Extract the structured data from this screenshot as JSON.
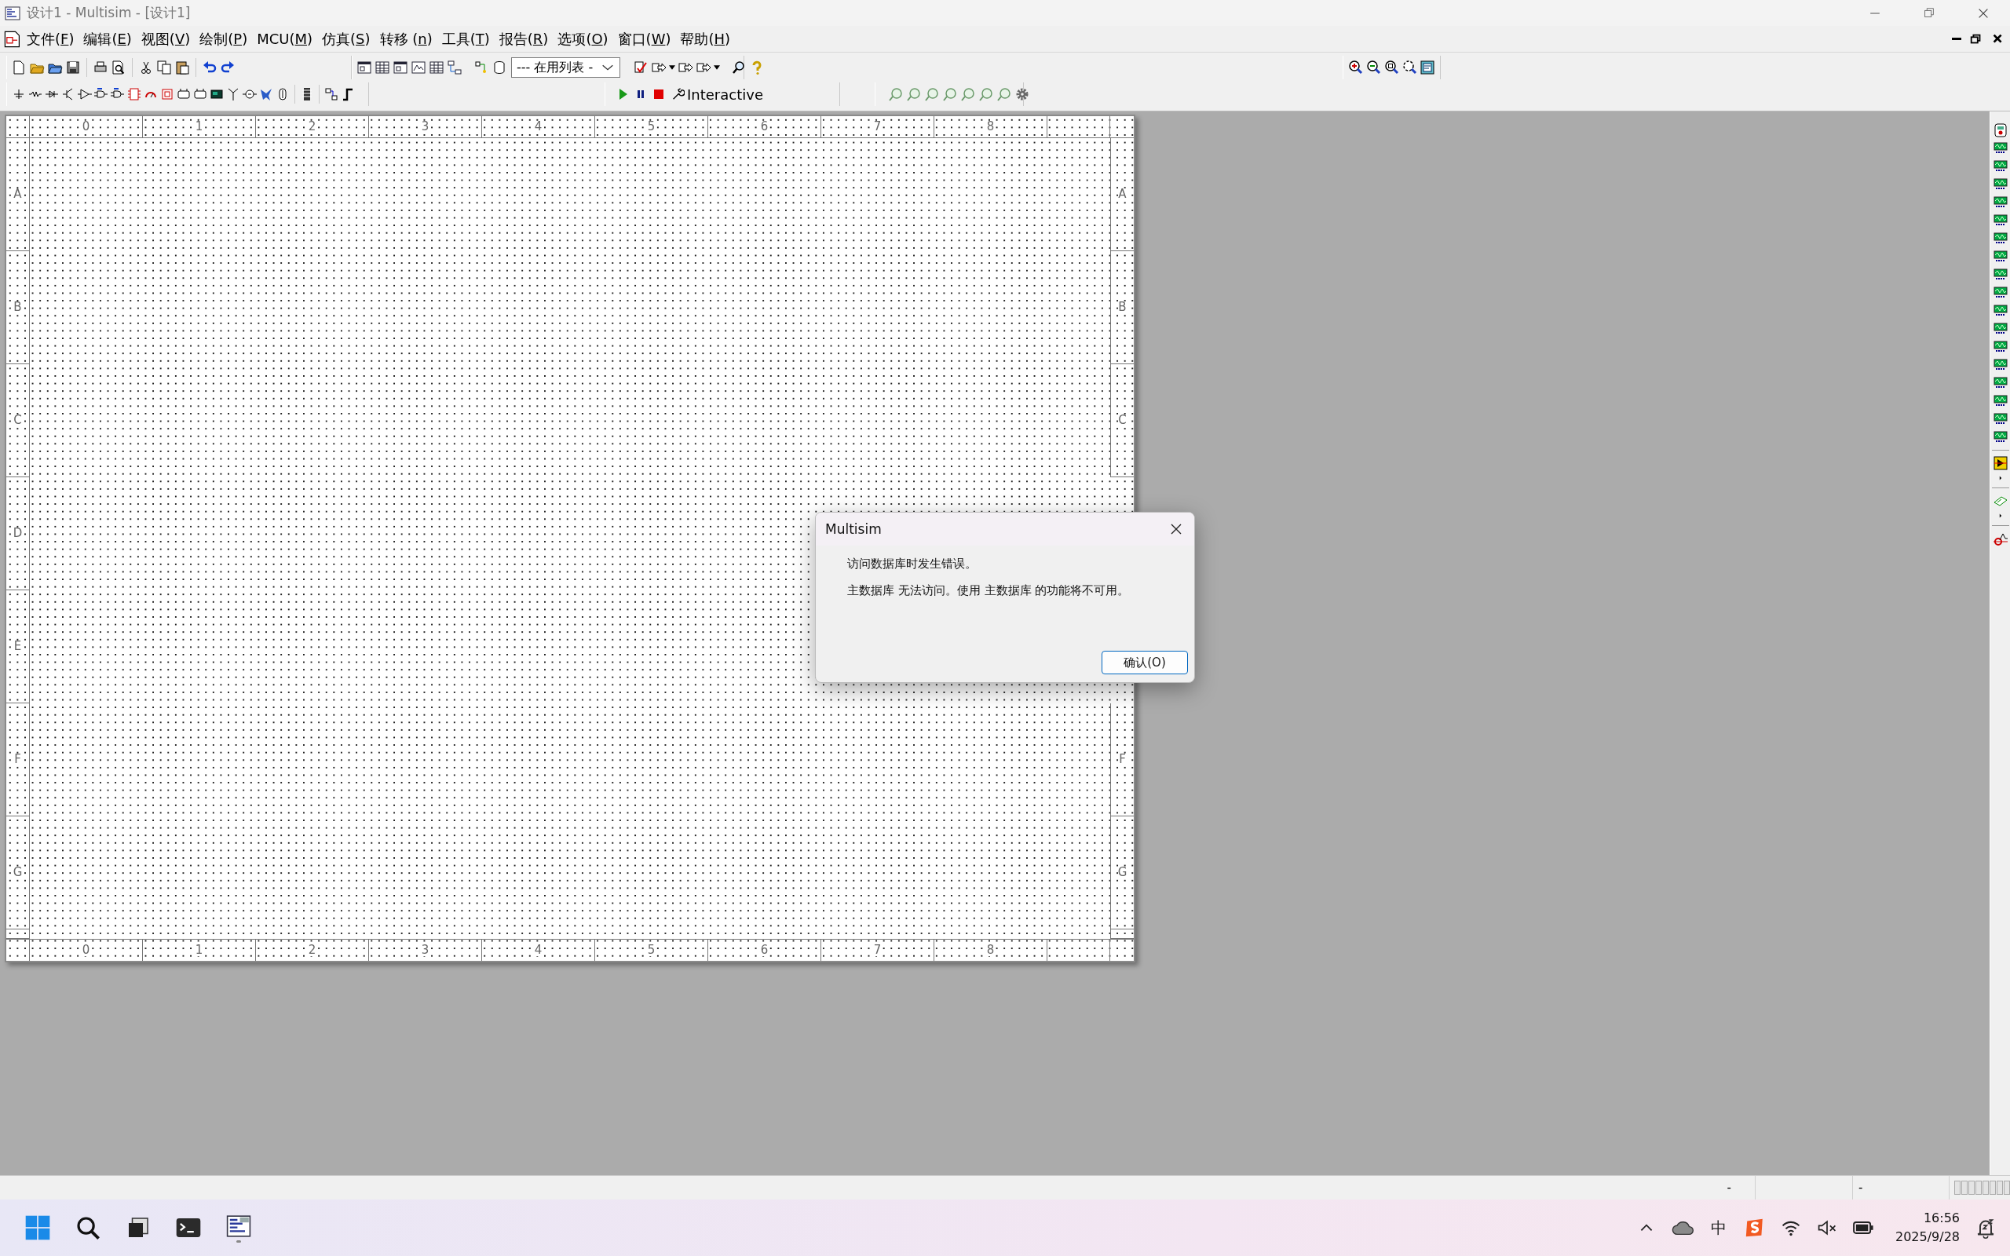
{
  "window": {
    "title": "设计1 - Multisim - [设计1]"
  },
  "menu_bar": {
    "items": [
      {
        "label": "文件(F)"
      },
      {
        "label": "编辑(E)"
      },
      {
        "label": "视图(V)"
      },
      {
        "label": "绘制(P)"
      },
      {
        "label": "MCU(M)"
      },
      {
        "label": "仿真(S)"
      },
      {
        "label": "转移 (n)"
      },
      {
        "label": "工具(T)"
      },
      {
        "label": "报告(R)"
      },
      {
        "label": "选项(O)"
      },
      {
        "label": "窗口(W)"
      },
      {
        "label": "帮助(H)"
      }
    ]
  },
  "toolbar": {
    "dropdown": {
      "value": "--- 在用列表 -"
    }
  },
  "simulation_toolbar": {
    "mode": "Interactive"
  },
  "sheet": {
    "top_ruler": [
      "0",
      "1",
      "2",
      "3",
      "4",
      "5",
      "6",
      "7",
      "8"
    ],
    "left_ruler": [
      "A",
      "B",
      "C",
      "D",
      "E",
      "F",
      "G"
    ],
    "right_ruler_upper": [
      "A",
      "B",
      "C"
    ],
    "right_ruler_lower": [
      "F",
      "G"
    ],
    "bottom_ruler": [
      "0",
      "1",
      "2",
      "3",
      "4",
      "5",
      "6",
      "7",
      "8"
    ]
  },
  "status_bar": {
    "cells": [
      "-",
      "-"
    ]
  },
  "dialog": {
    "title": "Multisim",
    "messages": [
      "访问数据库时发生错误。",
      "主数据库 无法访问。使用 主数据库 的功能将不可用。"
    ],
    "button": "确认(O)"
  },
  "taskbar": {
    "ime": "中",
    "time": "16:56",
    "date": "2025/9/28"
  }
}
